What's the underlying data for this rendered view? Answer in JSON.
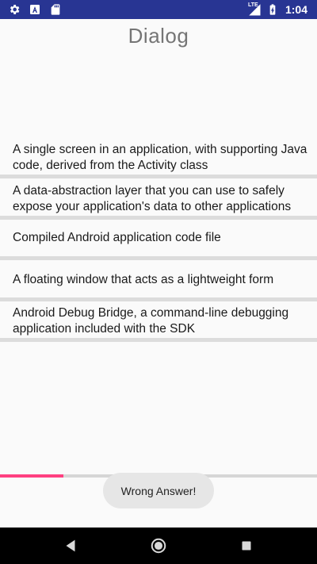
{
  "status_bar": {
    "time": "1:04",
    "network": "LTE",
    "icons": [
      "gear-icon",
      "text-a-icon",
      "sd-card-icon",
      "signal-icon",
      "battery-charging-icon"
    ]
  },
  "title": "Dialog",
  "options": [
    {
      "label": "A single screen in an application, with supporting Java code, derived from the Activity class"
    },
    {
      "label": "A data-abstraction layer that you can use to safely expose your application's data to other applications"
    },
    {
      "label": "Compiled Android application code file"
    },
    {
      "label": "A floating window that acts as a lightweight form"
    },
    {
      "label": "Android Debug Bridge, a command-line debugging application included with the SDK"
    }
  ],
  "progress": {
    "value": 0.2
  },
  "toast": {
    "message": "Wrong Answer!"
  },
  "nav_bar": {
    "icons": [
      "back-icon",
      "home-icon",
      "recents-icon"
    ]
  },
  "colors": {
    "status_bar": "#283593",
    "accent": "#ff4081",
    "title": "#757575"
  }
}
